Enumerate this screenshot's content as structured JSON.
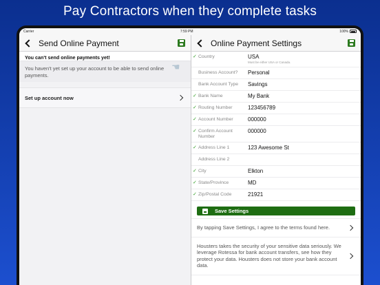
{
  "headline": "Pay Contractors when they complete tasks",
  "statusbar": {
    "carrier": "Carrier",
    "time": "7:59 PM",
    "battery": "100%"
  },
  "left": {
    "title": "Send Online Payment",
    "warning_title": "You can't send online payments yet!",
    "warning_body": "You haven't yet set up your account to be able to send online payments.",
    "setup_label": "Set up account now"
  },
  "right": {
    "title": "Online Payment Settings",
    "fields": [
      {
        "label": "Country",
        "value": "USA",
        "hint": "Must be either USA or Canada.",
        "checked": true
      },
      {
        "label": "Business Account?",
        "value": "Personal",
        "checked": false
      },
      {
        "label": "Bank Account Type",
        "value": "Savings",
        "checked": false
      },
      {
        "label": "Bank Name",
        "value": "My Bank",
        "checked": true
      },
      {
        "label": "Routing Number",
        "value": "123456789",
        "checked": true
      },
      {
        "label": "Account Number",
        "value": "000000",
        "checked": true
      },
      {
        "label": "Confirm Account Number",
        "value": "000000",
        "checked": true
      },
      {
        "label": "Address Line 1",
        "value": "123 Awesome St",
        "checked": true
      },
      {
        "label": "Address Line 2",
        "value": "",
        "checked": false
      },
      {
        "label": "City",
        "value": "Elkton",
        "checked": true
      },
      {
        "label": "State/Province",
        "value": "MD",
        "checked": true
      },
      {
        "label": "Zip/Postal Code",
        "value": "21921",
        "checked": true
      }
    ],
    "save_label": "Save Settings",
    "terms_text": "By tapping Save Settings, I agree to the terms found here.",
    "security_text": "Housters takes the security of your sensitive data seriously. We leverage Rotessa for bank account transfers, see how they protect your data. Housters does not store your bank account data."
  },
  "colors": {
    "accent_green": "#1e6d12",
    "check_green": "#2c9a1f",
    "background_blue": "#1c4fcf"
  }
}
